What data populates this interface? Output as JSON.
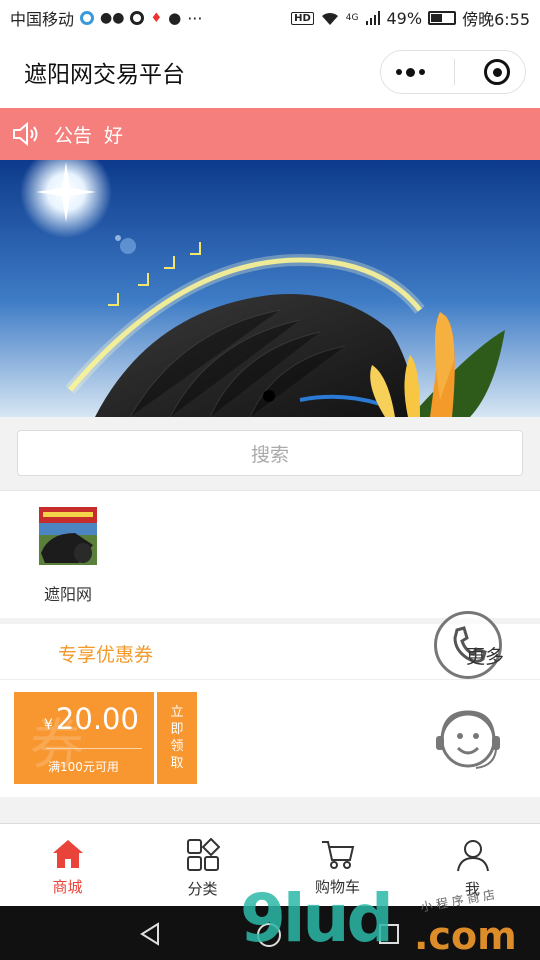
{
  "status_bar": {
    "carrier": "中国移动",
    "extra_icon": "···",
    "network": "4G",
    "battery": "49%",
    "time": "傍晚6:55",
    "battery_level": 0.49
  },
  "nav": {
    "title": "遮阳网交易平台"
  },
  "notice": {
    "label": "公告",
    "text": "好"
  },
  "search": {
    "placeholder": "搜索"
  },
  "categories": [
    {
      "label": "遮阳网",
      "icon": "shade-net-product-image"
    }
  ],
  "coupons": {
    "title": "专享优惠券",
    "items": [
      {
        "currency": "¥",
        "amount": "20.00",
        "condition": "满100元可用",
        "action": "立即领取",
        "watermark": "券"
      }
    ]
  },
  "floating": {
    "more_label": "更多"
  },
  "tabbar": [
    {
      "label": "商城",
      "icon": "home-icon",
      "active": true
    },
    {
      "label": "分类",
      "icon": "category-icon",
      "active": false
    },
    {
      "label": "购物车",
      "icon": "cart-icon",
      "active": false
    },
    {
      "label": "我",
      "icon": "user-icon",
      "active": false
    }
  ],
  "watermark": {
    "brand": "9lud",
    "domain": ".com",
    "small": "小 程 序 商 店"
  },
  "colors": {
    "notice_bg": "#f47f7d",
    "accent_orange": "#f8962f",
    "active_red": "#e9443a"
  }
}
